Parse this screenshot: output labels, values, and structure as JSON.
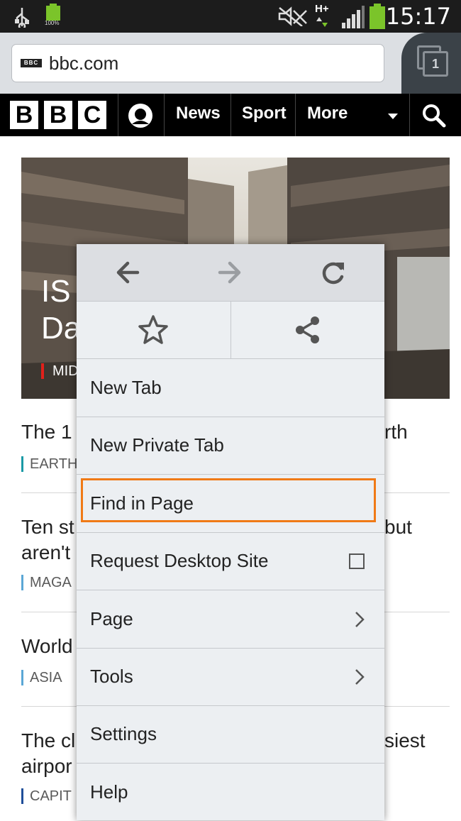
{
  "status_bar": {
    "battery_percent": "100%",
    "network_type": "H+",
    "time": "15:17"
  },
  "browser": {
    "url": "bbc.com",
    "favicon_text": "BBC",
    "tab_count": "1"
  },
  "bbc_nav": {
    "logo_letters": [
      "B",
      "B",
      "C"
    ],
    "items": [
      "News",
      "Sport",
      "More"
    ]
  },
  "hero": {
    "headline_line1": "IS",
    "headline_line2": "Da",
    "tag": "MID"
  },
  "articles": [
    {
      "title_left": "The 1",
      "title_right": "rth",
      "tag": "EARTH",
      "tag_color": "#1a9aa6"
    },
    {
      "title_left": "Ten st",
      "title_right": "but",
      "title_line2": "aren't",
      "tag": "MAGA",
      "tag_color": "#5ba7d6"
    },
    {
      "title_left": "World",
      "tag": "ASIA",
      "tag_color": "#5ba7d6"
    },
    {
      "title_left": "The cl",
      "title_right": "siest",
      "title_line2": "airpor",
      "tag": "CAPIT",
      "tag_color": "#1f4e99"
    }
  ],
  "menu": {
    "items": [
      {
        "label": "New Tab"
      },
      {
        "label": "New Private Tab"
      },
      {
        "label": "Find in Page"
      },
      {
        "label": "Request Desktop Site"
      },
      {
        "label": "Page"
      },
      {
        "label": "Tools"
      },
      {
        "label": "Settings"
      },
      {
        "label": "Help"
      }
    ]
  },
  "colors": {
    "highlight": "#f07a16",
    "bbc_red": "#e0211b"
  }
}
